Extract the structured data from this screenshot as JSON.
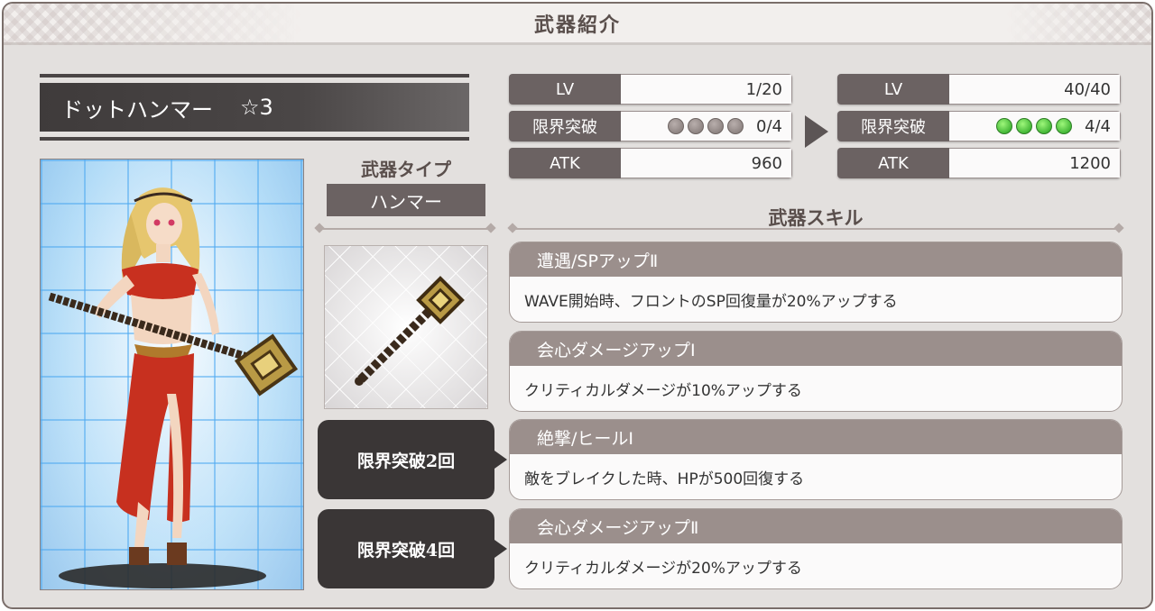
{
  "title": "武器紹介",
  "weapon": {
    "name": "ドットハンマー",
    "rarity": "☆3"
  },
  "weapon_type": {
    "label": "武器タイプ",
    "value": "ハンマー"
  },
  "stats_before": {
    "lv_label": "LV",
    "lv_value": "1/20",
    "limit_label": "限界突破",
    "limit_value": "0/4",
    "limit_filled": 0,
    "atk_label": "ATK",
    "atk_value": "960"
  },
  "stats_after": {
    "lv_label": "LV",
    "lv_value": "40/40",
    "limit_label": "限界突破",
    "limit_value": "4/4",
    "limit_filled": 4,
    "atk_label": "ATK",
    "atk_value": "1200"
  },
  "skills_title": "武器スキル",
  "skills": [
    {
      "name": "遭遇/SPアップⅡ",
      "desc": "WAVE開始時、フロントのSP回復量が20%アップする"
    },
    {
      "name": "会心ダメージアップⅠ",
      "desc": "クリティカルダメージが10%アップする"
    },
    {
      "name": "絶撃/ヒールⅠ",
      "desc": "敵をブレイクした時、HPが500回復する"
    },
    {
      "name": "会心ダメージアップⅡ",
      "desc": "クリティカルダメージが20%アップする"
    }
  ],
  "limit_breaks": [
    {
      "label": "限界突破2回"
    },
    {
      "label": "限界突破4回"
    }
  ],
  "colors": {
    "orb_on": "#1f9d1b",
    "orb_off": "#7e7472",
    "header_dark": "#6b6262"
  }
}
